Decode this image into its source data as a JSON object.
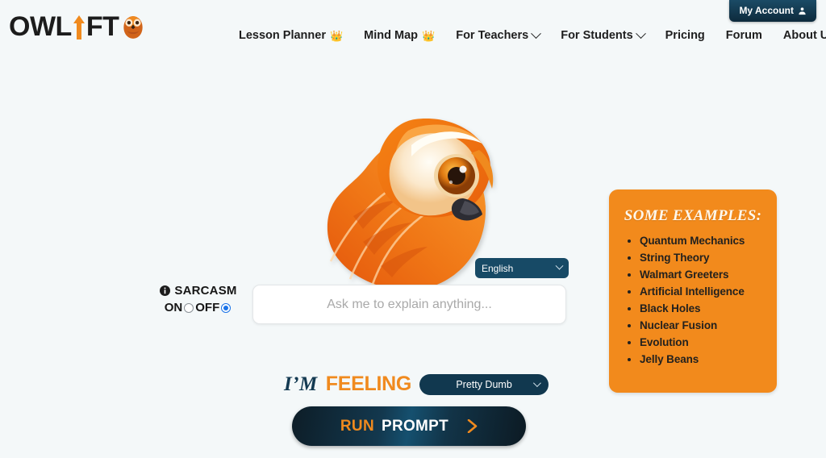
{
  "brand": {
    "logo_text_1": "OWL",
    "logo_text_2": "FT",
    "logo_arrow_icon": "up-arrow-icon",
    "logo_owl_icon": "owl-icon",
    "accent_orange": "#f08a1e",
    "accent_navy": "#11384f",
    "page_background": "#f4f8f9"
  },
  "header": {
    "account_button": "My Account",
    "account_icon": "user-icon",
    "nav": [
      {
        "label": "Lesson Planner",
        "badge": "👑",
        "has_chevron": false
      },
      {
        "label": "Mind Map",
        "badge": "👑",
        "has_chevron": false
      },
      {
        "label": "For Teachers",
        "badge": "",
        "has_chevron": true
      },
      {
        "label": "For Students",
        "badge": "",
        "has_chevron": true
      },
      {
        "label": "Pricing",
        "badge": "",
        "has_chevron": false
      },
      {
        "label": "Forum",
        "badge": "",
        "has_chevron": false
      },
      {
        "label": "About Us",
        "badge": "",
        "has_chevron": false
      }
    ]
  },
  "hero": {
    "mascot_icon": "owl-mascot-illustration"
  },
  "controls": {
    "language": {
      "selected": "English",
      "chevron_icon": "chevron-down-icon"
    },
    "sarcasm": {
      "label": "SARCASM",
      "info_icon": "info-icon",
      "on_label": "ON",
      "off_label": "OFF",
      "selected": "OFF",
      "selected_color": "#1a73e8"
    },
    "prompt": {
      "value": "",
      "placeholder": "Ask me to explain anything..."
    },
    "feeling": {
      "prefix_italic": "I’M",
      "prefix_bold": "FEELING",
      "selected": "Pretty Dumb",
      "chevron_icon": "chevron-down-icon"
    },
    "run_button": {
      "label_accent": "RUN",
      "label_main": "PROMPT",
      "arrow_icon": "chevron-right-icon"
    }
  },
  "examples": {
    "title": "SOME EXAMPLES:",
    "items": [
      "Quantum Mechanics",
      "String Theory",
      "Walmart Greeters",
      "Artificial Intelligence",
      "Black Holes",
      "Nuclear Fusion",
      "Evolution",
      "Jelly Beans"
    ]
  }
}
